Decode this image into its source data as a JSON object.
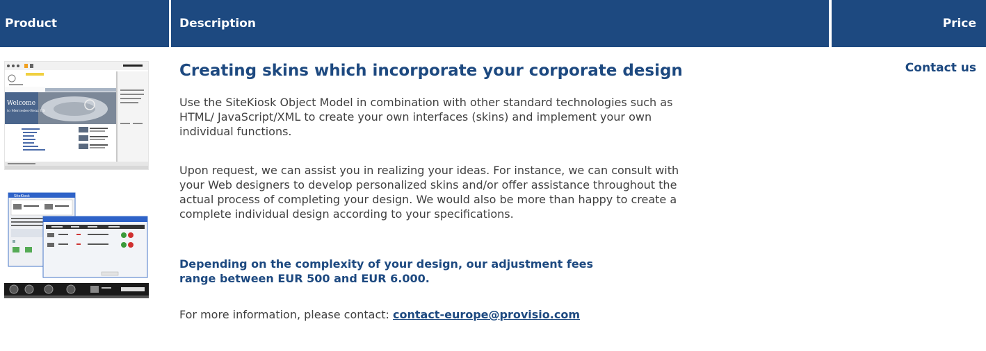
{
  "table": {
    "headers": {
      "product": "Product",
      "description": "Description",
      "price": "Price"
    }
  },
  "row": {
    "title": "Creating skins which incorporate your corporate design",
    "paragraph1": "Use the SiteKiosk Object Model in combination with other standard technologies such as HTML/ JavaScript/XML to create your own interfaces (skins) and implement your own individual functions.",
    "paragraph2": "Upon request, we can assist you in realizing your ideas. For instance, we can consult with your Web designers to develop personalized skins and/or offer assistance throughout the actual process of completing your design. We would also be more than happy to create a complete individual design according to your specifications.",
    "fee_note": "Depending on the complexity of your design, our adjustment fees range between EUR 500 and EUR 6.000.",
    "contact_prefix": "For more information, please contact: ",
    "contact_email": "contact-europe@provisio.com",
    "price": "Contact us"
  },
  "thumbnails": {
    "shot1_welcome": "Welcome",
    "shot1_subtitle": "to Mercedes-Benz US",
    "shot2_window_title": "SiteKiosk"
  },
  "colors": {
    "header_bg": "#1d4980",
    "accent": "#1d4980",
    "body_text": "#404040"
  }
}
